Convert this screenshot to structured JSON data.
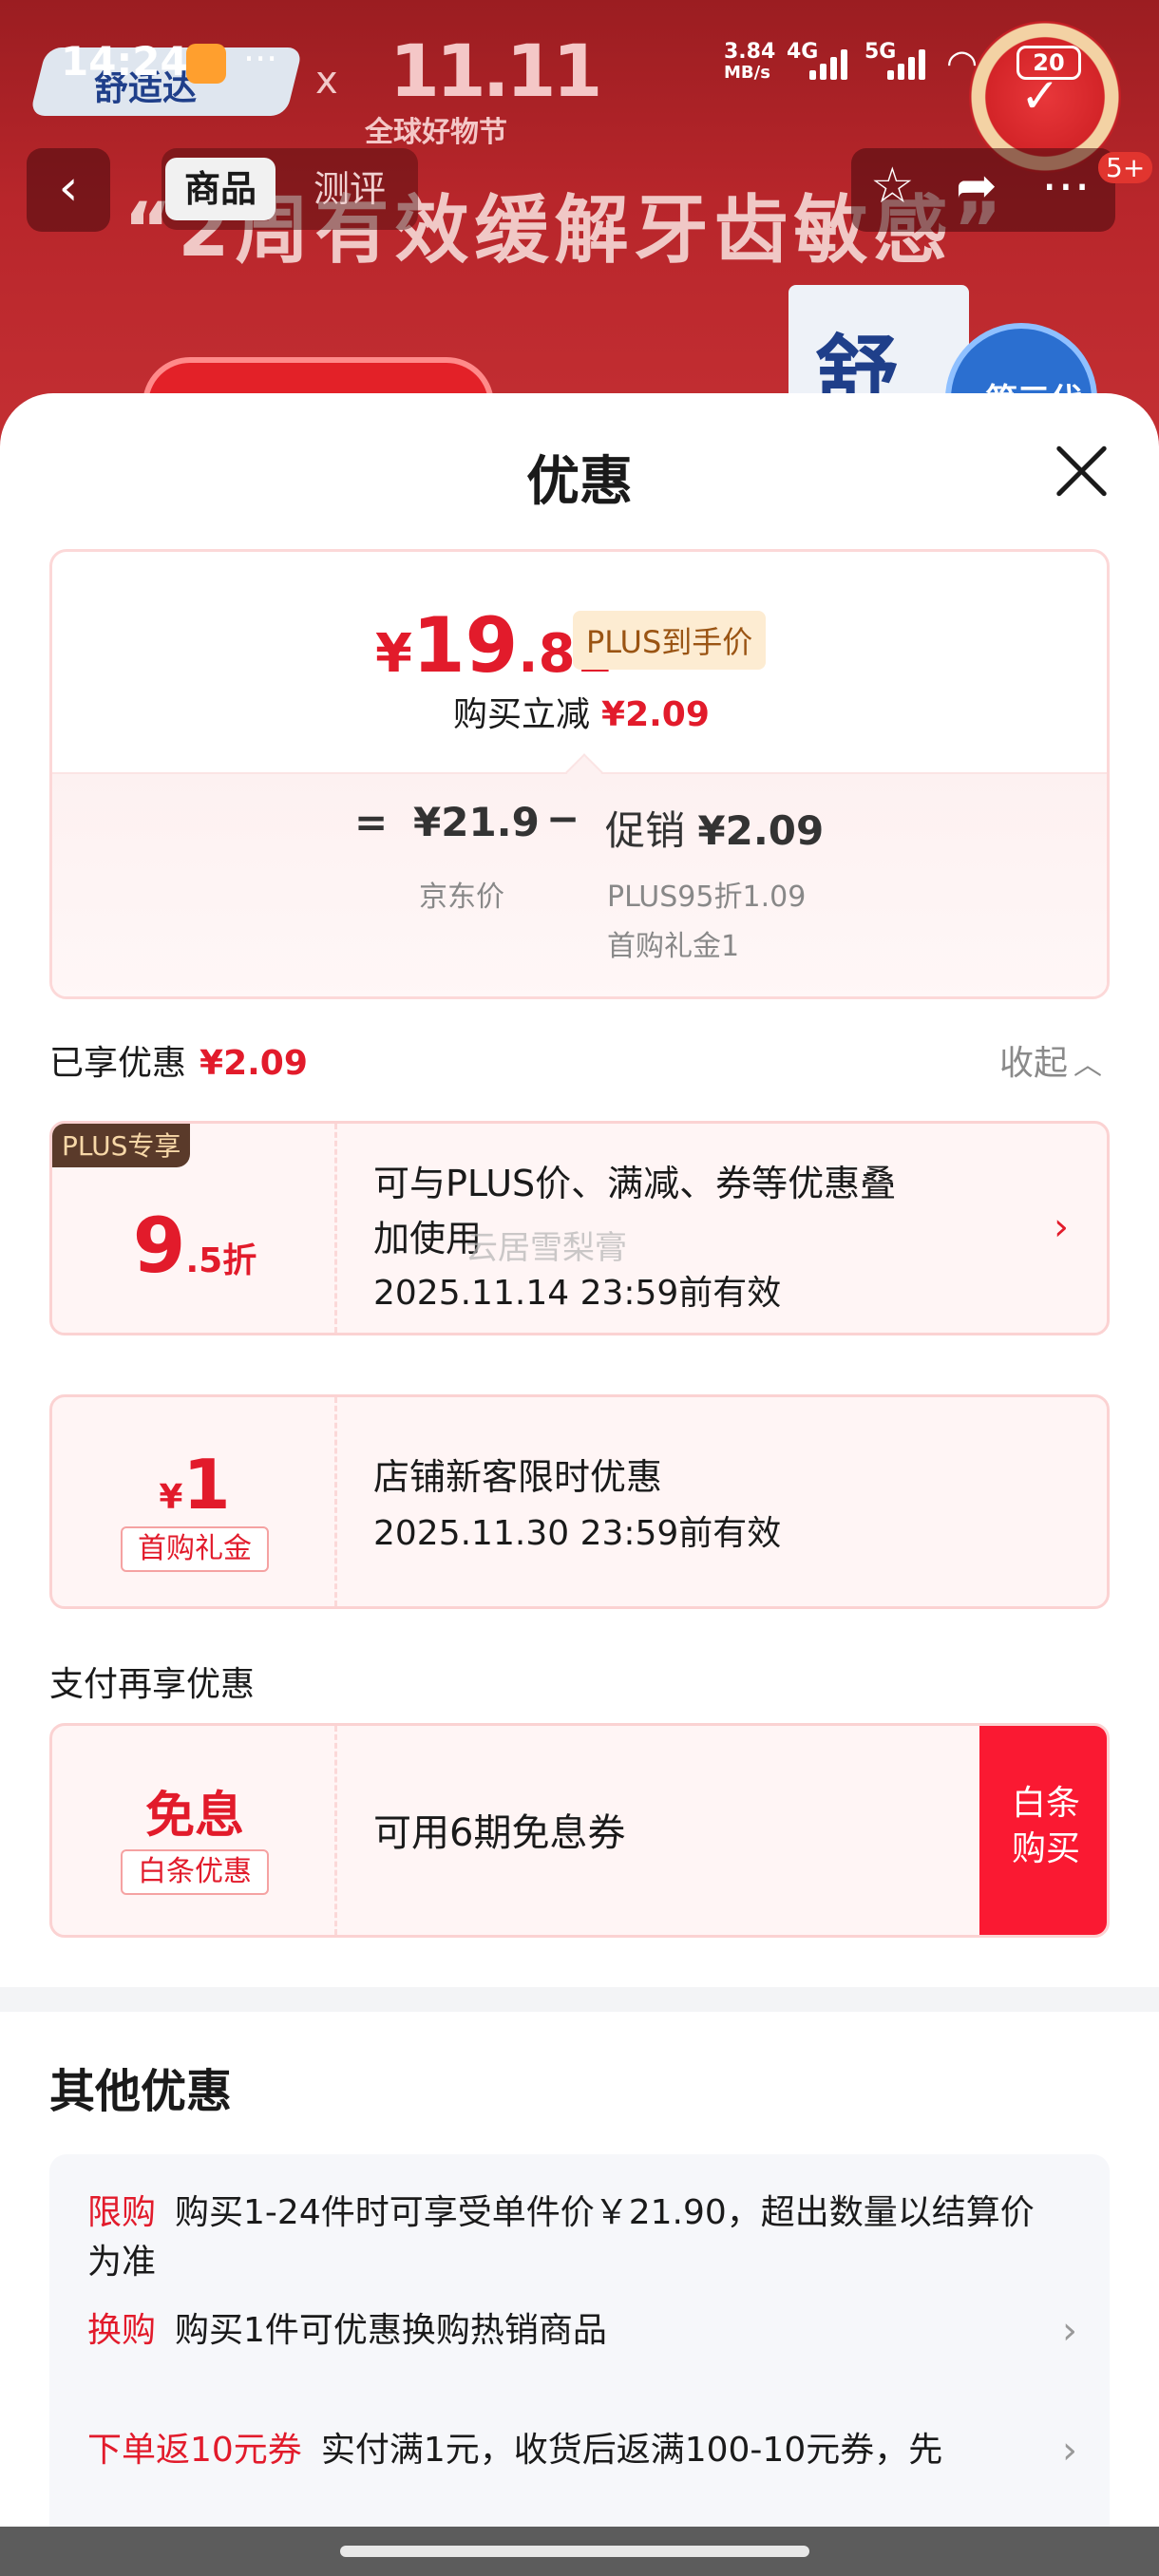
{
  "status_bar": {
    "time": "14:24",
    "more": "···",
    "speed_top": "3.84",
    "speed_bottom": "MB/s",
    "net1": "4G",
    "net2": "5G",
    "battery": "20"
  },
  "background": {
    "brand": "舒适达",
    "x": "x",
    "event_big": "11.11",
    "event_sub": "全球好物节",
    "headline": "“2周有效缓解牙齿敏感”",
    "product_glyph": "舒",
    "badge_text": "第三代"
  },
  "nav": {
    "back": "‹",
    "tabs": [
      "商品",
      "测评"
    ],
    "more_badge": "5+"
  },
  "sheet": {
    "title": "优惠",
    "price": {
      "yen": "¥",
      "integer": "19",
      "decimal": ".81",
      "tag": "PLUS到手价",
      "reduce_label": "购买立减",
      "reduce_value": "¥2.09",
      "eq": "=",
      "jd_price": "¥21.9",
      "jd_label": "京东价",
      "minus": "−",
      "promo_label": "促销",
      "promo_value": "¥2.09",
      "promo_detail1": "PLUS95折1.09",
      "promo_detail2": "首购礼金1"
    },
    "enjoyed": {
      "label": "已享优惠",
      "value": "¥2.09",
      "collapse": "收起"
    },
    "coupons": [
      {
        "corner": "PLUS专享",
        "big": "9",
        "small": ".5折",
        "line1": "可与PLUS价、满减、券等优惠叠",
        "line2": "加使用",
        "line3": "2025.11.14 23:59前有效"
      },
      {
        "yen": "¥",
        "big": "1",
        "tag": "首购礼金",
        "line1": "店铺新客限时优惠",
        "line2": "2025.11.30 23:59前有效"
      }
    ],
    "watermark": "云居雪梨膏",
    "pay_section": "支付再享优惠",
    "pay_coupon": {
      "big": "免息",
      "tag": "白条优惠",
      "text": "可用6期免息券",
      "button_l1": "白条",
      "button_l2": "购买"
    },
    "other_title": "其他优惠",
    "other_items": [
      {
        "key": "限购",
        "text": "购买1-24件时可享受单件价￥21.90，超出数量以结算价为准"
      },
      {
        "key": "换购",
        "text": "购买1件可优惠换购热销商品"
      },
      {
        "key": "下单返10元券",
        "text": "实付满1元，收货后返满100-10元券，先"
      }
    ]
  }
}
